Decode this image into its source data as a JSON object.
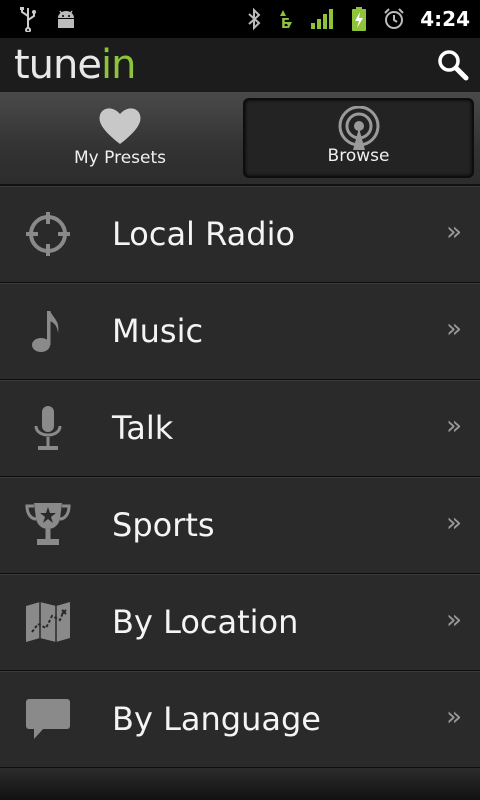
{
  "status_bar": {
    "time": "4:24",
    "icons": [
      "usb-icon",
      "android-debug-icon",
      "bluetooth-icon",
      "edge-data-icon",
      "signal-icon",
      "battery-charging-icon",
      "alarm-icon"
    ],
    "accent": "#8fc43a"
  },
  "header": {
    "logo_tune": "tune",
    "logo_in": "in",
    "search_icon": "search-icon"
  },
  "tabs": [
    {
      "label": "My Presets",
      "icon": "heart-icon",
      "selected": false
    },
    {
      "label": "Browse",
      "icon": "broadcast-icon",
      "selected": true
    }
  ],
  "menu": [
    {
      "label": "Local Radio",
      "icon": "crosshair-icon",
      "chevron": "»"
    },
    {
      "label": "Music",
      "icon": "music-note-icon",
      "chevron": "»"
    },
    {
      "label": "Talk",
      "icon": "microphone-icon",
      "chevron": "»"
    },
    {
      "label": "Sports",
      "icon": "trophy-icon",
      "chevron": "»"
    },
    {
      "label": "By Location",
      "icon": "map-icon",
      "chevron": "»"
    },
    {
      "label": "By Language",
      "icon": "speech-bubble-icon",
      "chevron": "»"
    }
  ]
}
